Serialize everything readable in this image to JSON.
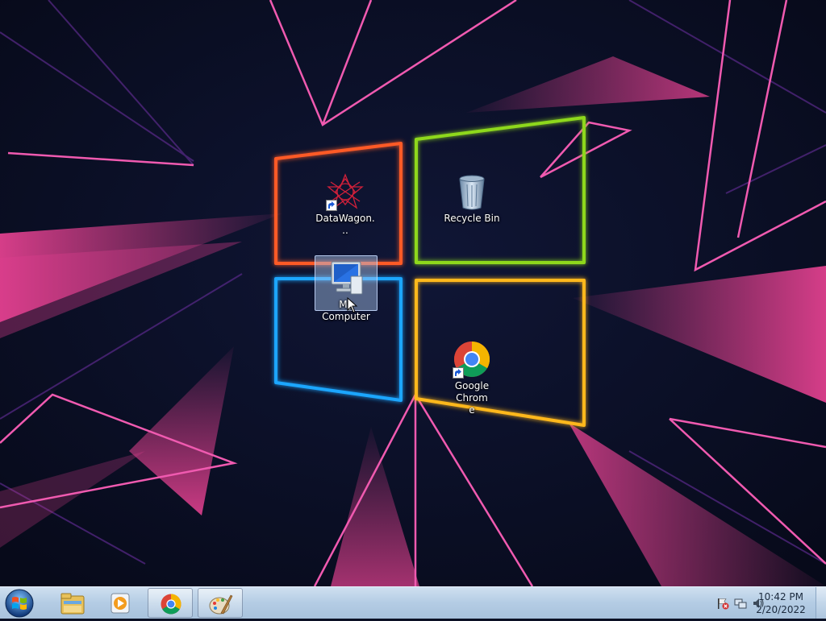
{
  "desktop": {
    "icons": [
      {
        "label": "DataWagon...",
        "icon": "datawagon-icon",
        "shortcut": true
      },
      {
        "label": "Recycle Bin",
        "icon": "recycle-bin-icon",
        "shortcut": false
      },
      {
        "label": "My Computer",
        "icon": "computer-icon",
        "shortcut": false,
        "selected": true
      },
      {
        "label": "Google Chrome",
        "icon": "chrome-icon",
        "shortcut": true
      }
    ]
  },
  "taskbar": {
    "start": {
      "icon": "windows-start-orb-icon"
    },
    "pinned": [
      {
        "name": "Windows Explorer",
        "icon": "folder-icon"
      },
      {
        "name": "Windows Media Player",
        "icon": "media-player-icon"
      },
      {
        "name": "Google Chrome",
        "icon": "chrome-icon",
        "active": true
      },
      {
        "name": "Paint",
        "icon": "paint-icon",
        "active": true
      }
    ],
    "tray": {
      "icons": [
        "action-center-flag-icon",
        "network-icon",
        "volume-icon"
      ],
      "time": "10:42 PM",
      "date": "2/20/2022"
    }
  },
  "colors": {
    "wallpaper_bg": "#0b1024",
    "pink": "#e0408e",
    "orange_pane": "#ff5a28",
    "green_pane": "#8ed81e",
    "blue_pane": "#1aa6ff",
    "yellow_pane": "#ffb81a"
  }
}
